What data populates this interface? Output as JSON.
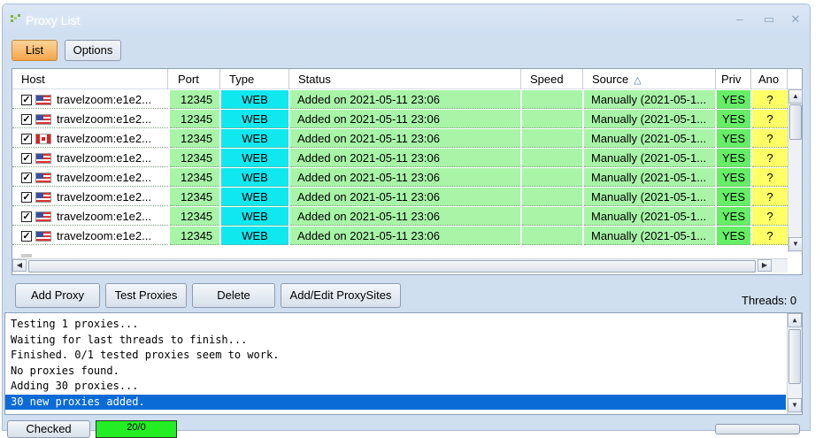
{
  "window": {
    "title": "Proxy List",
    "controls": {
      "minimize": "–",
      "maximize": "▭",
      "close": "✕"
    }
  },
  "tabs": [
    {
      "label": "List",
      "active": true
    },
    {
      "label": "Options",
      "active": false
    }
  ],
  "grid": {
    "columns": [
      "Host",
      "Port",
      "Type",
      "Status",
      "Speed",
      "Source",
      "Priv",
      "Ano"
    ],
    "sort_column": "Source",
    "sort_icon": "triangle-up-icon",
    "rows": [
      {
        "checked": true,
        "flag": "us",
        "host": "travelzoom:e1e2...",
        "port": "12345",
        "type": "WEB",
        "status": "Added on 2021-05-11 23:06",
        "speed": "",
        "source": "Manually (2021-05-1...",
        "priv": "YES",
        "ano": "?"
      },
      {
        "checked": true,
        "flag": "us",
        "host": "travelzoom:e1e2...",
        "port": "12345",
        "type": "WEB",
        "status": "Added on 2021-05-11 23:06",
        "speed": "",
        "source": "Manually (2021-05-1...",
        "priv": "YES",
        "ano": "?"
      },
      {
        "checked": true,
        "flag": "ca",
        "host": "travelzoom:e1e2...",
        "port": "12345",
        "type": "WEB",
        "status": "Added on 2021-05-11 23:06",
        "speed": "",
        "source": "Manually (2021-05-1...",
        "priv": "YES",
        "ano": "?"
      },
      {
        "checked": true,
        "flag": "us",
        "host": "travelzoom:e1e2...",
        "port": "12345",
        "type": "WEB",
        "status": "Added on 2021-05-11 23:06",
        "speed": "",
        "source": "Manually (2021-05-1...",
        "priv": "YES",
        "ano": "?"
      },
      {
        "checked": true,
        "flag": "us",
        "host": "travelzoom:e1e2...",
        "port": "12345",
        "type": "WEB",
        "status": "Added on 2021-05-11 23:06",
        "speed": "",
        "source": "Manually (2021-05-1...",
        "priv": "YES",
        "ano": "?"
      },
      {
        "checked": true,
        "flag": "us",
        "host": "travelzoom:e1e2...",
        "port": "12345",
        "type": "WEB",
        "status": "Added on 2021-05-11 23:06",
        "speed": "",
        "source": "Manually (2021-05-1...",
        "priv": "YES",
        "ano": "?"
      },
      {
        "checked": true,
        "flag": "us",
        "host": "travelzoom:e1e2...",
        "port": "12345",
        "type": "WEB",
        "status": "Added on 2021-05-11 23:06",
        "speed": "",
        "source": "Manually (2021-05-1...",
        "priv": "YES",
        "ano": "?"
      },
      {
        "checked": true,
        "flag": "us",
        "host": "travelzoom:e1e2...",
        "port": "12345",
        "type": "WEB",
        "status": "Added on 2021-05-11 23:06",
        "speed": "",
        "source": "Manually (2021-05-1...",
        "priv": "YES",
        "ano": "?"
      }
    ]
  },
  "actions": {
    "add_proxy": "Add Proxy",
    "test_proxies": "Test Proxies",
    "delete": "Delete",
    "add_edit_proxysites": "Add/Edit ProxySites",
    "threads_label": "Threads: 0"
  },
  "log": {
    "lines": [
      "Testing 1 proxies...",
      "Waiting for last threads to finish...",
      "Finished. 0/1 tested proxies seem to work.",
      "No proxies found.",
      "Adding 30 proxies...",
      "30 new proxies added."
    ],
    "selected_index": 5
  },
  "footer": {
    "checked_button": "Checked",
    "count": "20/0"
  },
  "colors": {
    "port_bg": "#a8f5a8",
    "type_bg": "#10e8f0",
    "priv_bg": "#66ee66",
    "ano_bg": "#ffff66",
    "selection": "#0a6bd6",
    "active_tab": "#f4a44a"
  }
}
